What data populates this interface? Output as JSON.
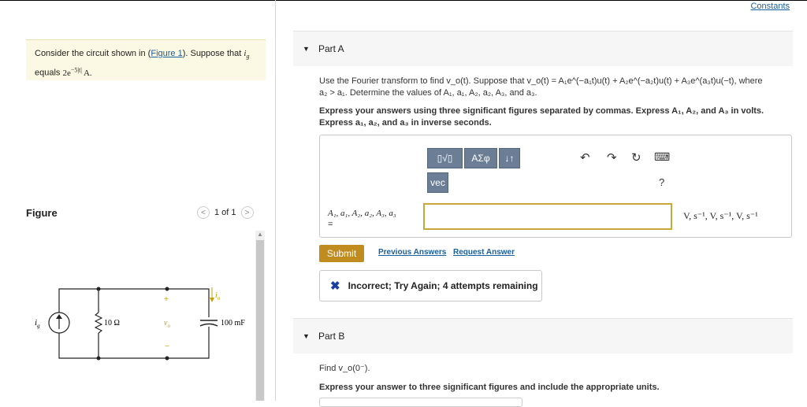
{
  "left": {
    "intro_before_link": "Consider the circuit shown in (",
    "figure_link": "Figure 1",
    "intro_after_link": "). Suppose that",
    "ig_symbol": "i",
    "ig_sub": "g",
    "equals_label": "equals",
    "value_base": "2e",
    "value_exp": "−5|t|",
    "unit": "A",
    "figure_title": "Figure",
    "pager_prev": "<",
    "pager_text": "1 of 1",
    "pager_next": ">",
    "circuit": {
      "source_label": "i",
      "source_sub": "g",
      "resistor_label": "10 Ω",
      "capacitor_label": "100 mF",
      "vo_label": "v",
      "vo_sub": "o",
      "io_label": "i",
      "io_sub": "o",
      "plus": "+",
      "minus": "−"
    }
  },
  "right": {
    "constants_link": "Constants",
    "part_a": {
      "title": "Part A",
      "question_line1": "Use the Fourier transform to find v_o(t). Suppose that v_o(t) = A₁e^(−a₁t)u(t) + A₂e^(−a₂t)u(t) + A₃e^(a₃t)u(−t), where",
      "question_line2": "a₂ > a₁. Determine the values of A₁, a₁, A₂, a₂, A₃, and a₃.",
      "instructions_line1": "Express your answers using three significant figures separated by commas. Express A₁, A₂, and A₃ in volts.",
      "instructions_line2": "Express a₁, a₂, and a₃ in inverse seconds.",
      "toolbar": {
        "templates_label": "▯√▯",
        "symbols_label": "ΑΣφ",
        "sort_label": "↓↑",
        "vec_label": "vec",
        "undo_icon": "↶",
        "redo_icon": "↷",
        "reset_icon": "↻",
        "keyboard_icon": "⌨",
        "help_label": "?"
      },
      "answer_label": "A₁, a₁, A₂, a₂, A₃, a₃",
      "answer_eq": "=",
      "answer_value": "",
      "answer_units": "V, s⁻¹, V, s⁻¹, V, s⁻¹",
      "submit_label": "Submit",
      "previous_answers_label": "Previous Answers",
      "request_answer_label": "Request Answer",
      "feedback_icon": "✖",
      "feedback_text": "Incorrect; Try Again; 4 attempts remaining"
    },
    "part_b": {
      "title": "Part B",
      "question": "Find v_o(0⁻).",
      "instructions": "Express your answer to three significant figures and include the appropriate units."
    }
  },
  "colors": {
    "accent_link": "#1a5fa0",
    "submit_bg": "#c08b1f",
    "input_border": "#c8a838",
    "toolbar_bg": "#6b7e96",
    "feedback_x": "#1b3fa0"
  }
}
